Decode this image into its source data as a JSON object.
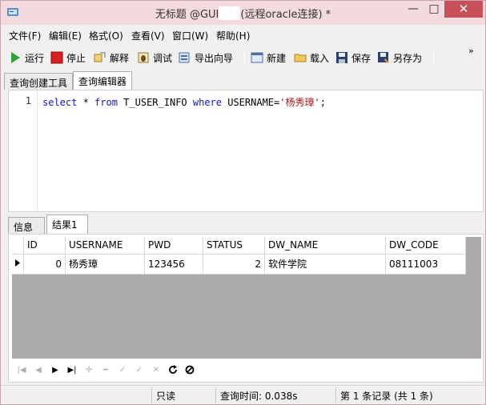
{
  "window": {
    "title_prefix": "无标题 @GUI",
    "title_suffix": "(远程oracle连接) *",
    "min_label": "—",
    "max_label": "□",
    "close_label": "✕"
  },
  "menu": [
    "文件(F)",
    "编辑(E)",
    "格式(O)",
    "查看(V)",
    "窗口(W)",
    "帮助(H)"
  ],
  "toolbar": {
    "run": "运行",
    "stop": "停止",
    "explain": "解释",
    "debug": "调试",
    "export_wizard": "导出向导",
    "new": "新建",
    "load": "载入",
    "save": "保存",
    "save_as": "另存为",
    "more": "»"
  },
  "tabs": [
    "查询创建工具",
    "查询编辑器"
  ],
  "editor": {
    "line_number": "1",
    "code_kw1": "select",
    "code_star": " * ",
    "code_kw2": "from",
    "code_table": " T_USER_INFO ",
    "code_kw3": "where",
    "code_cond": " USERNAME=",
    "code_string": "'杨秀璋'",
    "code_end": ";"
  },
  "result_tabs": [
    "信息",
    "结果1"
  ],
  "grid": {
    "columns": [
      "ID",
      "USERNAME",
      "PWD",
      "STATUS",
      "DW_NAME",
      "DW_CODE"
    ],
    "rows": [
      [
        "0",
        "杨秀璋",
        "123456",
        "2",
        "软件学院",
        "08111003"
      ]
    ]
  },
  "statusbar": {
    "mode": "只读",
    "query_time": "查询时间: 0.038s",
    "record_info": "第 1 条记录 (共 1 条)"
  },
  "colors": {
    "keyword": "#1313d6",
    "string": "#a31515",
    "close": "#c7505a"
  }
}
